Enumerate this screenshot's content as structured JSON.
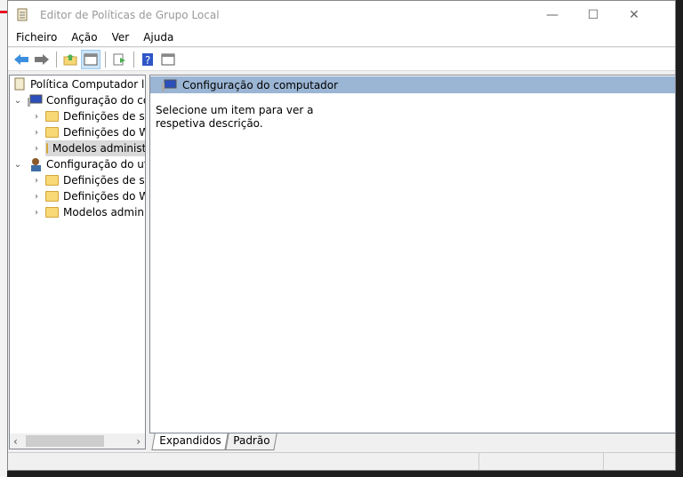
{
  "window": {
    "title": "Editor de Políticas de Grupo Local",
    "minimize": "—",
    "maximize": "☐",
    "close": "✕"
  },
  "menu": [
    "Ficheiro",
    "Ação",
    "Ver",
    "Ajuda"
  ],
  "tree": {
    "root": "Política Computador local",
    "nodes": [
      {
        "label": "Configuração do computador",
        "children": [
          "Definições de software",
          "Definições do Windows",
          "Modelos administrativos"
        ]
      },
      {
        "label": "Configuração do utilizador",
        "children": [
          "Definições de software",
          "Definições do Windows",
          "Modelos administrativos"
        ]
      }
    ],
    "selected": "Modelos administrativos"
  },
  "detail": {
    "header": "Configuração do computador",
    "description": "Selecione um item para ver a respetiva descrição."
  },
  "tabs": [
    "Expandidos",
    "Padrão"
  ],
  "colors": {
    "header": "#9bb5d4",
    "selection": "#d9d9d9"
  }
}
